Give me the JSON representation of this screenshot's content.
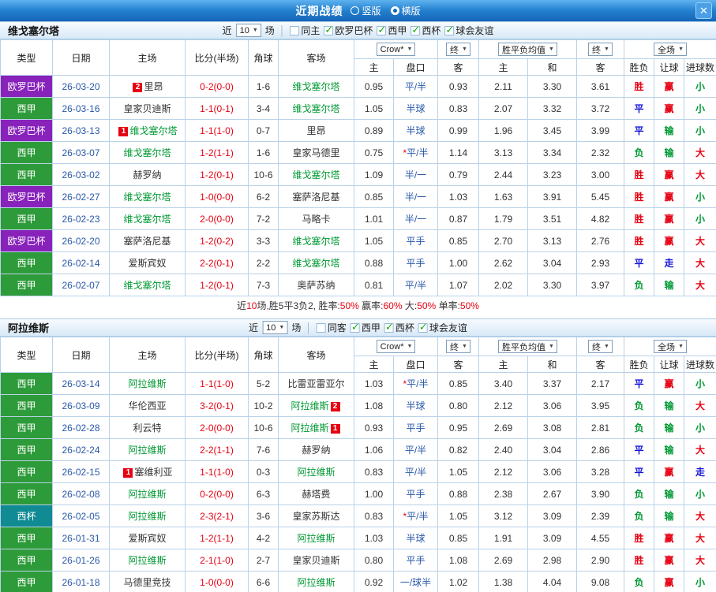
{
  "titlebar": {
    "title": "近期战绩",
    "radios": [
      {
        "label": "竖版",
        "selected": false
      },
      {
        "label": "横版",
        "selected": true
      }
    ],
    "close_icon": "✕"
  },
  "header": {
    "static_cols": [
      "类型",
      "日期",
      "主场",
      "比分(半场)",
      "角球",
      "客场"
    ],
    "dropdowns": [
      {
        "label": "Crow*",
        "span": 2
      },
      {
        "label": "终",
        "span": 1
      },
      {
        "label": "胜平负均值",
        "span": 2
      },
      {
        "label": "终",
        "span": 1
      },
      {
        "label": "全场",
        "span": 3
      }
    ],
    "sub_cols": [
      "主",
      "盘口",
      "客",
      "主",
      "和",
      "客",
      "胜负",
      "让球",
      "进球数"
    ]
  },
  "colors": {
    "league": {
      "欧罗巴杯": "#8822bb",
      "西甲": "#2e9b3a",
      "西杯": "#108a93"
    },
    "result": {
      "胜": "#e60012",
      "赢": "#e60012",
      "大": "#e60012",
      "平": "#1515d9",
      "走": "#1515d9",
      "负": "#009933",
      "输": "#009933",
      "小": "#009933"
    },
    "focus_team": "#009933",
    "score": "#e60012",
    "badge_bg": "#e60012"
  },
  "sections": [
    {
      "team": "维戈塞尔塔",
      "filters": {
        "near": "近",
        "count": "10",
        "unit": "场",
        "same": {
          "label": "同主",
          "checked": false
        },
        "leagues": [
          {
            "label": "欧罗巴杯",
            "checked": true
          },
          {
            "label": "西甲",
            "checked": true
          },
          {
            "label": "西杯",
            "checked": true
          },
          {
            "label": "球会友谊",
            "checked": true
          }
        ]
      },
      "rows": [
        {
          "league": "欧罗巴杯",
          "date": "26-03-20",
          "home": "里昂",
          "home_badge": "2",
          "score": "0-2(0-0)",
          "corner": "1-6",
          "away": "维戈塞尔塔",
          "odds": [
            "0.95",
            "平/半",
            "0.93"
          ],
          "avg": [
            "2.11",
            "3.30",
            "3.61"
          ],
          "res": [
            "胜",
            "赢",
            "小"
          ]
        },
        {
          "league": "西甲",
          "date": "26-03-16",
          "home": "皇家贝迪斯",
          "score": "1-1(0-1)",
          "corner": "3-4",
          "away": "维戈塞尔塔",
          "odds": [
            "1.05",
            "半球",
            "0.83"
          ],
          "avg": [
            "2.07",
            "3.32",
            "3.72"
          ],
          "res": [
            "平",
            "赢",
            "小"
          ]
        },
        {
          "league": "欧罗巴杯",
          "date": "26-03-13",
          "home": "维戈塞尔塔",
          "home_badge": "1",
          "score": "1-1(1-0)",
          "corner": "0-7",
          "away": "里昂",
          "odds": [
            "0.89",
            "半球",
            "0.99"
          ],
          "avg": [
            "1.96",
            "3.45",
            "3.99"
          ],
          "res": [
            "平",
            "输",
            "小"
          ]
        },
        {
          "league": "西甲",
          "date": "26-03-07",
          "home": "维戈塞尔塔",
          "score": "1-2(1-1)",
          "corner": "1-6",
          "away": "皇家马德里",
          "odds": [
            "0.75",
            "*平/半",
            "1.14"
          ],
          "avg": [
            "3.13",
            "3.34",
            "2.32"
          ],
          "res": [
            "负",
            "输",
            "大"
          ]
        },
        {
          "league": "西甲",
          "date": "26-03-02",
          "home": "赫罗纳",
          "score": "1-2(0-1)",
          "corner": "10-6",
          "away": "维戈塞尔塔",
          "odds": [
            "1.09",
            "半/一",
            "0.79"
          ],
          "avg": [
            "2.44",
            "3.23",
            "3.00"
          ],
          "res": [
            "胜",
            "赢",
            "大"
          ]
        },
        {
          "league": "欧罗巴杯",
          "date": "26-02-27",
          "home": "维戈塞尔塔",
          "score": "1-0(0-0)",
          "corner": "6-2",
          "away": "塞萨洛尼基",
          "odds": [
            "0.85",
            "半/一",
            "1.03"
          ],
          "avg": [
            "1.63",
            "3.91",
            "5.45"
          ],
          "res": [
            "胜",
            "赢",
            "小"
          ]
        },
        {
          "league": "西甲",
          "date": "26-02-23",
          "home": "维戈塞尔塔",
          "score": "2-0(0-0)",
          "corner": "7-2",
          "away": "马略卡",
          "odds": [
            "1.01",
            "半/一",
            "0.87"
          ],
          "avg": [
            "1.79",
            "3.51",
            "4.82"
          ],
          "res": [
            "胜",
            "赢",
            "小"
          ]
        },
        {
          "league": "欧罗巴杯",
          "date": "26-02-20",
          "home": "塞萨洛尼基",
          "score": "1-2(0-2)",
          "corner": "3-3",
          "away": "维戈塞尔塔",
          "odds": [
            "1.05",
            "平手",
            "0.85"
          ],
          "avg": [
            "2.70",
            "3.13",
            "2.76"
          ],
          "res": [
            "胜",
            "赢",
            "大"
          ]
        },
        {
          "league": "西甲",
          "date": "26-02-14",
          "home": "爱斯宾奴",
          "score": "2-2(0-1)",
          "corner": "2-2",
          "away": "维戈塞尔塔",
          "odds": [
            "0.88",
            "平手",
            "1.00"
          ],
          "avg": [
            "2.62",
            "3.04",
            "2.93"
          ],
          "res": [
            "平",
            "走",
            "大"
          ]
        },
        {
          "league": "西甲",
          "date": "26-02-07",
          "home": "维戈塞尔塔",
          "score": "1-2(0-1)",
          "corner": "7-3",
          "away": "奥萨苏纳",
          "odds": [
            "0.81",
            "平/半",
            "1.07"
          ],
          "avg": [
            "2.02",
            "3.30",
            "3.97"
          ],
          "res": [
            "负",
            "输",
            "大"
          ]
        }
      ],
      "summary": [
        {
          "t": "近"
        },
        {
          "t": "10",
          "c": "#e60012"
        },
        {
          "t": "场,胜5平3负2, 胜率:"
        },
        {
          "t": "50%",
          "c": "#e60012"
        },
        {
          "t": " 赢率:"
        },
        {
          "t": "60%",
          "c": "#e60012"
        },
        {
          "t": " 大:"
        },
        {
          "t": "50%",
          "c": "#e60012"
        },
        {
          "t": " 单率:"
        },
        {
          "t": "50%",
          "c": "#e60012"
        }
      ]
    },
    {
      "team": "阿拉维斯",
      "filters": {
        "near": "近",
        "count": "10",
        "unit": "场",
        "same": {
          "label": "同客",
          "checked": false
        },
        "leagues": [
          {
            "label": "西甲",
            "checked": true
          },
          {
            "label": "西杯",
            "checked": true
          },
          {
            "label": "球会友谊",
            "checked": true
          }
        ]
      },
      "rows": [
        {
          "league": "西甲",
          "date": "26-03-14",
          "home": "阿拉维斯",
          "score": "1-1(1-0)",
          "corner": "5-2",
          "away": "比雷亚雷亚尔",
          "odds": [
            "1.03",
            "*平/半",
            "0.85"
          ],
          "avg": [
            "3.40",
            "3.37",
            "2.17"
          ],
          "res": [
            "平",
            "赢",
            "小"
          ]
        },
        {
          "league": "西甲",
          "date": "26-03-09",
          "home": "华伦西亚",
          "score": "3-2(0-1)",
          "corner": "10-2",
          "away": "阿拉维斯",
          "away_badge": "2",
          "odds": [
            "1.08",
            "半球",
            "0.80"
          ],
          "avg": [
            "2.12",
            "3.06",
            "3.95"
          ],
          "res": [
            "负",
            "输",
            "大"
          ]
        },
        {
          "league": "西甲",
          "date": "26-02-28",
          "home": "利云特",
          "score": "2-0(0-0)",
          "corner": "10-6",
          "away": "阿拉维斯",
          "away_badge": "1",
          "odds": [
            "0.93",
            "平手",
            "0.95"
          ],
          "avg": [
            "2.69",
            "3.08",
            "2.81"
          ],
          "res": [
            "负",
            "输",
            "小"
          ]
        },
        {
          "league": "西甲",
          "date": "26-02-24",
          "home": "阿拉维斯",
          "score": "2-2(1-1)",
          "corner": "7-6",
          "away": "赫罗纳",
          "odds": [
            "1.06",
            "平/半",
            "0.82"
          ],
          "avg": [
            "2.40",
            "3.04",
            "2.86"
          ],
          "res": [
            "平",
            "输",
            "大"
          ]
        },
        {
          "league": "西甲",
          "date": "26-02-15",
          "home": "塞维利亚",
          "home_badge": "1",
          "score": "1-1(1-0)",
          "corner": "0-3",
          "away": "阿拉维斯",
          "odds": [
            "0.83",
            "平/半",
            "1.05"
          ],
          "avg": [
            "2.12",
            "3.06",
            "3.28"
          ],
          "res": [
            "平",
            "赢",
            "走"
          ]
        },
        {
          "league": "西甲",
          "date": "26-02-08",
          "home": "阿拉维斯",
          "score": "0-2(0-0)",
          "corner": "6-3",
          "away": "赫塔费",
          "odds": [
            "1.00",
            "平手",
            "0.88"
          ],
          "avg": [
            "2.38",
            "2.67",
            "3.90"
          ],
          "res": [
            "负",
            "输",
            "小"
          ]
        },
        {
          "league": "西杯",
          "date": "26-02-05",
          "home": "阿拉维斯",
          "score": "2-3(2-1)",
          "corner": "3-6",
          "away": "皇家苏斯达",
          "odds": [
            "0.83",
            "*平/半",
            "1.05"
          ],
          "avg": [
            "3.12",
            "3.09",
            "2.39"
          ],
          "res": [
            "负",
            "输",
            "大"
          ]
        },
        {
          "league": "西甲",
          "date": "26-01-31",
          "home": "爱斯宾奴",
          "score": "1-2(1-1)",
          "corner": "4-2",
          "away": "阿拉维斯",
          "odds": [
            "1.03",
            "半球",
            "0.85"
          ],
          "avg": [
            "1.91",
            "3.09",
            "4.55"
          ],
          "res": [
            "胜",
            "赢",
            "大"
          ]
        },
        {
          "league": "西甲",
          "date": "26-01-26",
          "home": "阿拉维斯",
          "score": "2-1(1-0)",
          "corner": "2-7",
          "away": "皇家贝迪斯",
          "odds": [
            "0.80",
            "平手",
            "1.08"
          ],
          "avg": [
            "2.69",
            "2.98",
            "2.90"
          ],
          "res": [
            "胜",
            "赢",
            "大"
          ]
        },
        {
          "league": "西甲",
          "date": "26-01-18",
          "home": "马德里竞技",
          "score": "1-0(0-0)",
          "corner": "6-6",
          "away": "阿拉维斯",
          "odds": [
            "0.92",
            "一/球半",
            "1.02"
          ],
          "avg": [
            "1.38",
            "4.04",
            "9.08"
          ],
          "res": [
            "负",
            "赢",
            "小"
          ]
        }
      ]
    }
  ]
}
